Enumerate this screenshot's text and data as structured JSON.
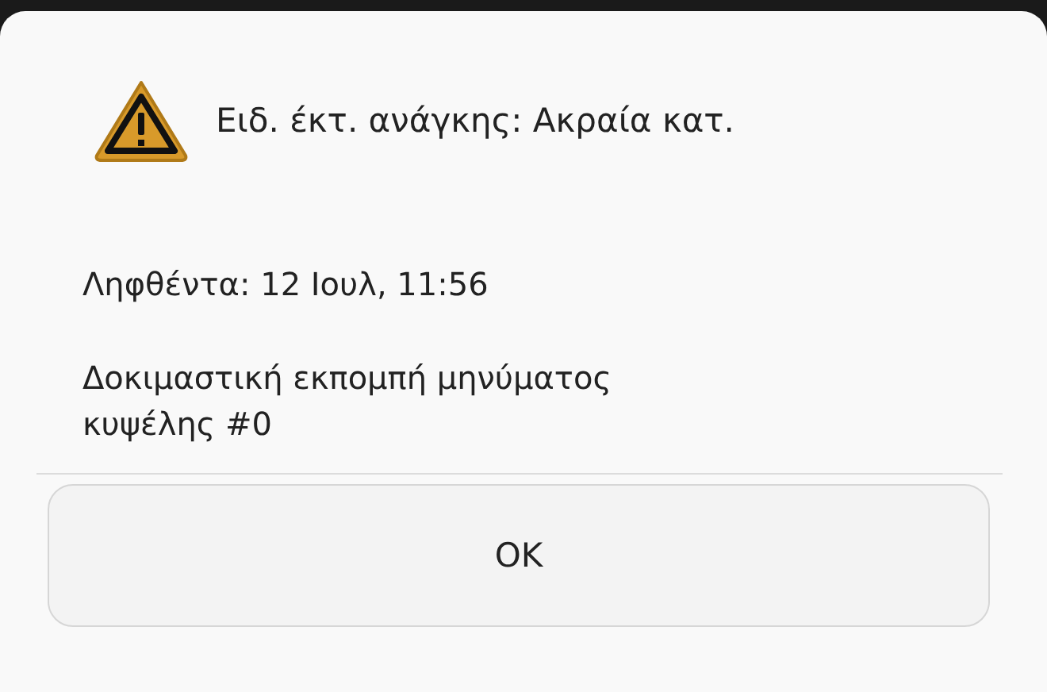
{
  "dialog": {
    "title": "Ειδ. έκτ. ανάγκης: Ακραία κατ.",
    "received": "Ληφθέντα: 12 Ιουλ, 11:56",
    "message": "Δοκιμαστική εκπομπή μηνύματος κυψέλης #0",
    "buttons": [
      "OK"
    ]
  }
}
